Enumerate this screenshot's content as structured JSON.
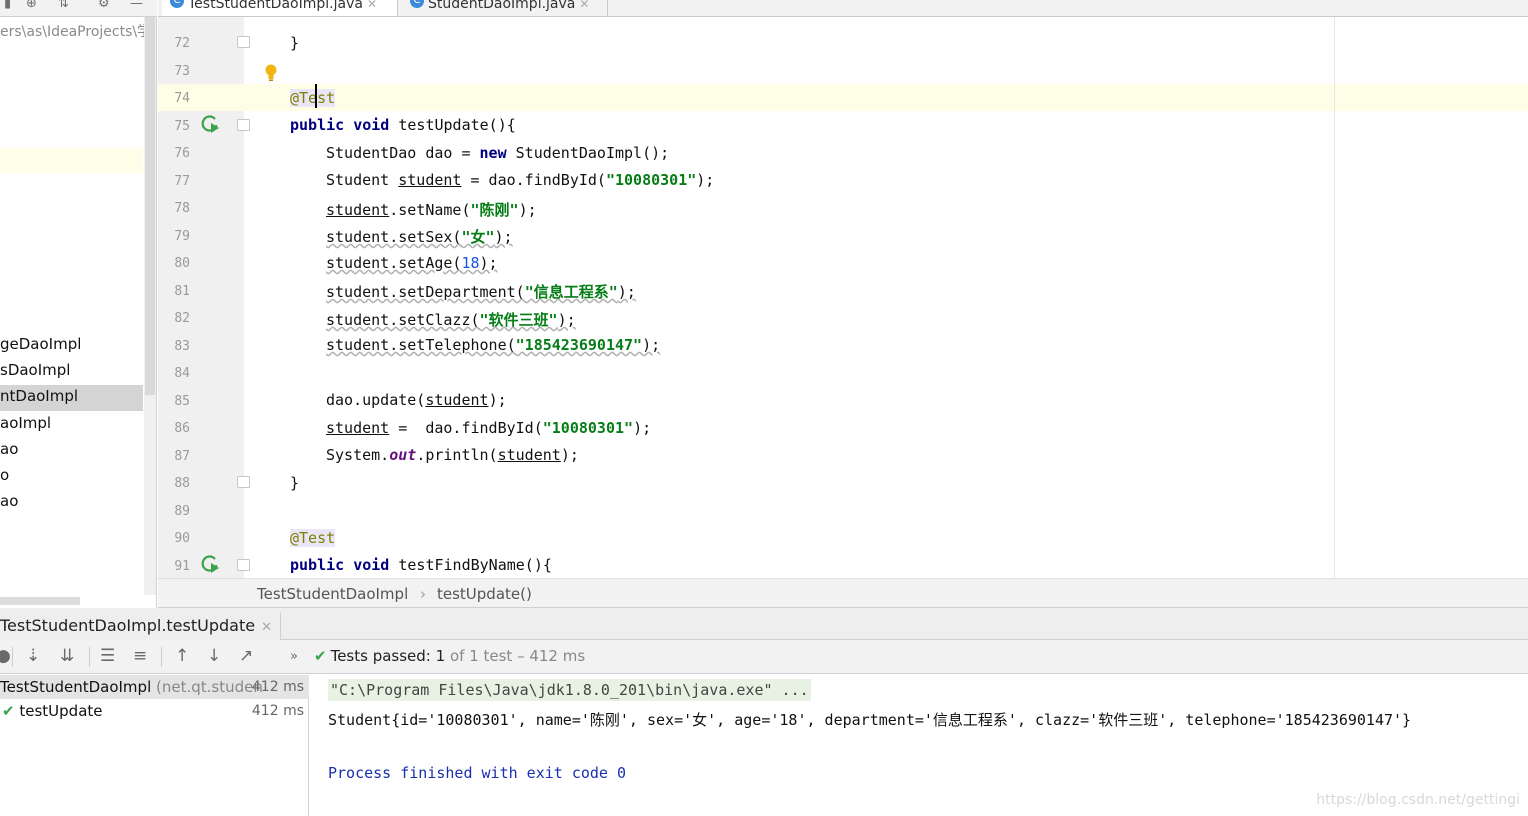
{
  "editor_tabs": [
    {
      "label": "TestStudentDaoImpl.java",
      "icon": "class-icon",
      "active": true
    },
    {
      "label": "StudentDaoImpl.java",
      "icon": "class-icon",
      "active": false
    }
  ],
  "project": {
    "path": "ers\\as\\IdeaProjects\\学",
    "items": [
      "geDaoImpl",
      "sDaoImpl",
      "ntDaoImpl",
      "aoImpl",
      "ao",
      "o",
      "ao"
    ],
    "selected_index": 2
  },
  "editor": {
    "line_numbers": [
      "72",
      "73",
      "74",
      "75",
      "76",
      "77",
      "78",
      "79",
      "80",
      "81",
      "82",
      "83",
      "84",
      "85",
      "86",
      "87",
      "88",
      "89",
      "90",
      "91"
    ],
    "current_line": "74"
  },
  "code": {
    "l72": "}",
    "l74_ann": "@Test",
    "l75_kw1": "public",
    "l75_kw2": "void",
    "l75_rest": " testUpdate(){",
    "l76_a": "StudentDao dao = ",
    "l76_kw": "new",
    "l76_b": " StudentDaoImpl();",
    "l77_a": "Student ",
    "l77_var": "student",
    "l77_b": " = dao.findById(",
    "l77_str": "\"10080301\"",
    "l77_c": ");",
    "l78_var": "student",
    "l78_a": ".setName(",
    "l78_str": "\"陈刚\"",
    "l78_b": ");",
    "l79_var": "student",
    "l79_a": ".setSex(",
    "l79_str": "\"女\"",
    "l79_b": ");",
    "l80_var": "student",
    "l80_a": ".setAge(",
    "l80_num": "18",
    "l80_b": ");",
    "l81_var": "student",
    "l81_a": ".setDepartment(",
    "l81_str": "\"信息工程系\"",
    "l81_b": ");",
    "l82_var": "student",
    "l82_a": ".setClazz(",
    "l82_str": "\"软件三班\"",
    "l82_b": ");",
    "l83_var": "student",
    "l83_a": ".setTelephone(",
    "l83_str": "\"185423690147\"",
    "l83_b": ");",
    "l85_a": "dao.update(",
    "l85_var": "student",
    "l85_b": ");",
    "l86_var": "student",
    "l86_a": " =  dao.findById(",
    "l86_str": "\"10080301\"",
    "l86_b": ");",
    "l87_a": "System.",
    "l87_it": "out",
    "l87_b": ".println(",
    "l87_var": "student",
    "l87_c": ");",
    "l88": "}",
    "l90_ann": "@Test",
    "l91_kw1": "public",
    "l91_kw2": "void",
    "l91_rest": " testFindByName(){"
  },
  "breadcrumb": {
    "class": "TestStudentDaoImpl",
    "sep": "›",
    "method": "testUpdate()"
  },
  "run": {
    "tab_label": "TestStudentDaoImpl.testUpdate",
    "status_label": "Tests passed:",
    "passed_count": "1",
    "status_rest": "of 1 test – 412 ms",
    "tree": {
      "root_name": "TestStudentDaoImpl",
      "root_pkg": "(net.qt.studen",
      "root_time": "412 ms",
      "child_name": "testUpdate",
      "child_time": "412 ms"
    },
    "console": {
      "cmd": "\"C:\\Program Files\\Java\\jdk1.8.0_201\\bin\\java.exe\" ...",
      "output": "Student{id='10080301', name='陈刚', sex='女', age='18', department='信息工程系', clazz='软件三班', telephone='185423690147'}",
      "finished": "Process finished with exit code 0"
    },
    "watermark": "https://blog.csdn.net/gettingi"
  },
  "colors": {
    "keyword": "#000080",
    "string": "#067d17",
    "number": "#1750eb",
    "annotation": "#808000",
    "success": "#3aa34a"
  }
}
